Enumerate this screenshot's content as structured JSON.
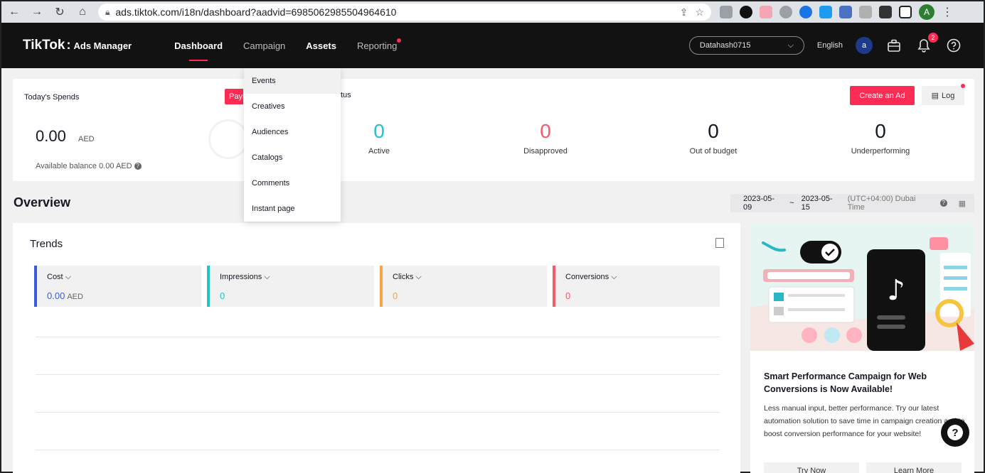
{
  "browser": {
    "url": "ads.tiktok.com/i18n/dashboard?aadvid=6985062985504964610",
    "profile_initial": "A"
  },
  "header": {
    "logo_main": "TikTok",
    "logo_colon": ":",
    "logo_sub": "Ads Manager",
    "nav": [
      "Dashboard",
      "Campaign",
      "Assets",
      "Reporting"
    ],
    "account": "Datahash0715",
    "language": "English",
    "user_initial": "a",
    "notifications_count": "2"
  },
  "dropdown": {
    "items": [
      "Events",
      "Creatives",
      "Audiences",
      "Catalogs",
      "Comments",
      "Instant page"
    ]
  },
  "spends": {
    "title": "Today's Spends",
    "value": "0.00",
    "unit": "AED",
    "balance": "Available balance 0.00 AED",
    "pay_button_partial": "Paym"
  },
  "status": {
    "title_partial": "tus",
    "active_value": "0",
    "active_label": "Active",
    "disapproved_value": "0",
    "disapproved_label": "Disapproved",
    "budget_value": "0",
    "budget_label": "Out of budget",
    "under_value": "0",
    "under_label": "Underperforming",
    "create_button": "Create an Ad",
    "log_button": "Log"
  },
  "overview": {
    "title": "Overview",
    "date_start": "2023-05-09",
    "date_sep": "~",
    "date_end": "2023-05-15",
    "timezone": "(UTC+04:00) Dubai Time"
  },
  "trends": {
    "title": "Trends",
    "cost_label": "Cost",
    "cost_value": "0.00",
    "cost_unit": "AED",
    "impr_label": "Impressions",
    "impr_value": "0",
    "clicks_label": "Clicks",
    "clicks_value": "0",
    "conv_label": "Conversions",
    "conv_value": "0"
  },
  "promo": {
    "title": "Smart Performance Campaign for Web Conversions is Now Available!",
    "text": "Less manual input, better performance. Try our latest automation solution to save time in campaign creation and to boost conversion performance for your website!",
    "btn_try": "Try Now",
    "btn_learn": "Learn More"
  },
  "colors": {
    "brand": "#fe2c55",
    "cost": "#3b5bdb",
    "impressions": "#25c2c7",
    "clicks": "#f5a64a",
    "conversions": "#f25a6a"
  }
}
